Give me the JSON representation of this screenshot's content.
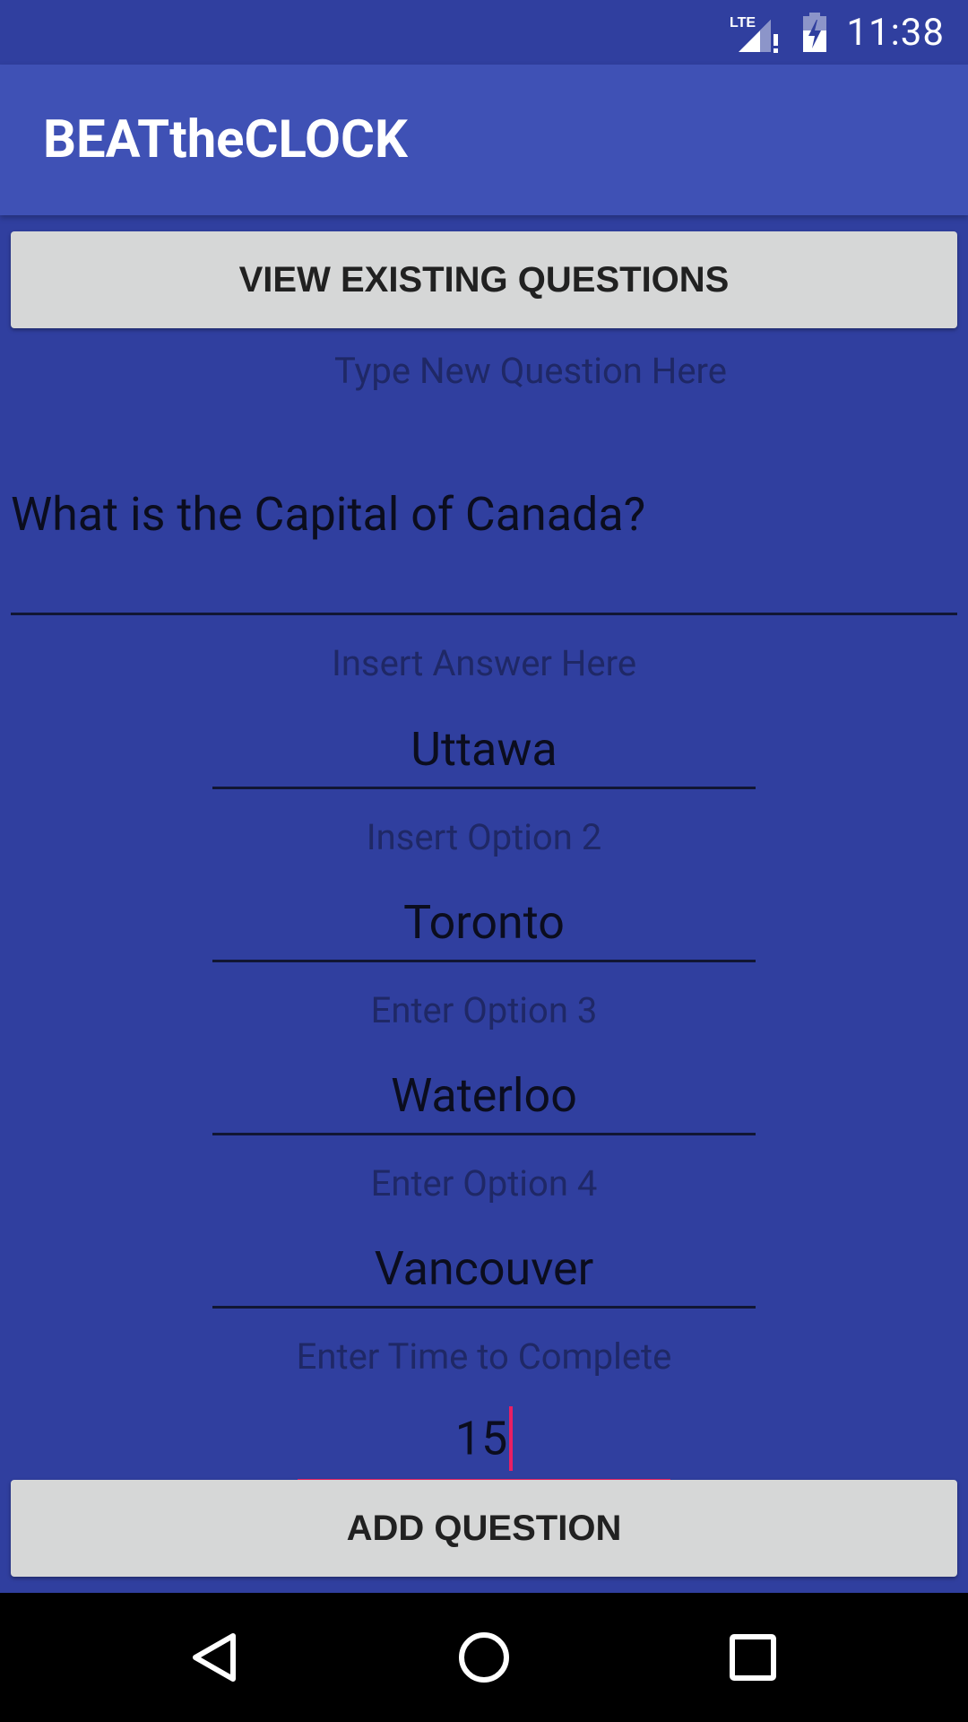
{
  "status_bar": {
    "network": "LTE",
    "time": "11:38",
    "icons": [
      "lte-signal-icon",
      "battery-charging-icon"
    ]
  },
  "app_bar": {
    "title": "BEATtheCLOCK"
  },
  "buttons": {
    "view_existing": "VIEW EXISTING QUESTIONS",
    "add_question": "ADD QUESTION"
  },
  "form": {
    "question": {
      "label": "Type New Question Here",
      "value": "What is the Capital of Canada?"
    },
    "answer": {
      "label": "Insert Answer Here",
      "value": "Uttawa"
    },
    "option2": {
      "label": "Insert Option 2",
      "value": "Toronto"
    },
    "option3": {
      "label": "Enter Option 3",
      "value": "Waterloo"
    },
    "option4": {
      "label": "Enter Option 4",
      "value": "Vancouver"
    },
    "time": {
      "label": "Enter Time to Complete",
      "value": "15"
    }
  },
  "navigation": {
    "icons": [
      "back-icon",
      "home-icon",
      "recents-icon"
    ]
  },
  "colors": {
    "primary_dark": "#303f9f",
    "primary": "#3f51b5",
    "accent": "#e91e63",
    "button": "#d6d7d7"
  }
}
